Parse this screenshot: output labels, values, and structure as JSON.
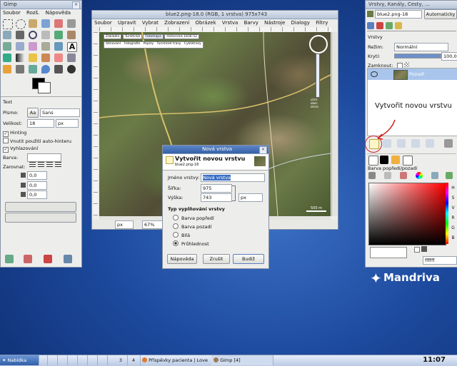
{
  "toolbox": {
    "title": "Gimp",
    "menu": [
      "Soubor",
      "Rozš.",
      "Nápověda"
    ],
    "tool_options": {
      "heading": "Text",
      "font_label": "Písmo:",
      "font_value": "Sans",
      "size_label": "Velikost:",
      "size_value": "18",
      "size_unit": "px",
      "hinting": "Hinting",
      "autohinter": "Vnutit použití auto-hinteru",
      "antialias": "Vyhlazování",
      "color_label": "Barva:",
      "justify_label": "Zarovnat:",
      "indent_value": "0,0",
      "line_spacing_value": "0,0",
      "letter_spacing_value": "0,0"
    }
  },
  "image_window": {
    "title": "blue2.png-18.0 (RGB, 1 vrstva) 975x743",
    "menu": [
      "Soubor",
      "Upravit",
      "Vybrat",
      "Zobrazení",
      "Obrázek",
      "Vrstva",
      "Barvy",
      "Nástroje",
      "Dialogy",
      "Filtry"
    ],
    "map_tabs": [
      "Základní",
      "Turistická",
      "Fotomapa",
      "Historická 1836-52"
    ],
    "map_options": [
      "Stínování",
      "Fotografie",
      "Popisy",
      "Turistické trasy",
      "Cyklotrasy"
    ],
    "scale_labels": [
      "ulice",
      "obec",
      "okres"
    ],
    "scale_value": "500 m",
    "unit": "px",
    "zoom": "67%"
  },
  "layers_dock": {
    "title": "Vrstvy, Kanály, Cesty, ...",
    "image_select": "blue2.png-18",
    "auto_button": "Automaticky",
    "layers_label": "Vrstvy",
    "mode_label": "Režim:",
    "mode_value": "Normální",
    "opacity_label": "Krytí:",
    "opacity_value": "100,0",
    "opacity_level": 1.0,
    "lock_label": "Zamknout:",
    "layer_name": "Pozadí",
    "annotation": "Vytvořit novou vrstvu",
    "color_panel_title": "Barva popředí/pozadí",
    "hsv_letters": [
      "H",
      "S",
      "V",
      "R",
      "G",
      "B"
    ],
    "hex_value": "ffffff"
  },
  "dialog": {
    "title": "Nová vrstva",
    "heading": "Vytvořit novou vrstvu",
    "subheading": "blue2.png-18",
    "name_label": "Jméno vrstvy:",
    "name_value": "Nová vrstva",
    "width_label": "Šířka:",
    "width_value": "975",
    "height_label": "Výška:",
    "height_value": "743",
    "unit": "px",
    "fill_title": "Typ vyplňování vrstvy",
    "fill_options": [
      "Barva popředí",
      "Barva pozadí",
      "Bílá",
      "Průhlednost"
    ],
    "fill_selected": 3,
    "help_button": "Nápověda",
    "cancel_button": "Zrušit",
    "ok_button": "Budiž"
  },
  "desktop": {
    "brand": "Mandriva"
  },
  "taskbar": {
    "start_label": "Nabídka",
    "desktops": [
      "3",
      "4"
    ],
    "tasks": [
      "Příspěvky pacienta | Love",
      "Gimp [4]"
    ],
    "clock": "11:07"
  },
  "colors": {
    "desktop_blue": "#1d4a9e",
    "title_active": "#3460a8",
    "selection": "#a9c5ec",
    "annotation_red": "#d22020"
  }
}
